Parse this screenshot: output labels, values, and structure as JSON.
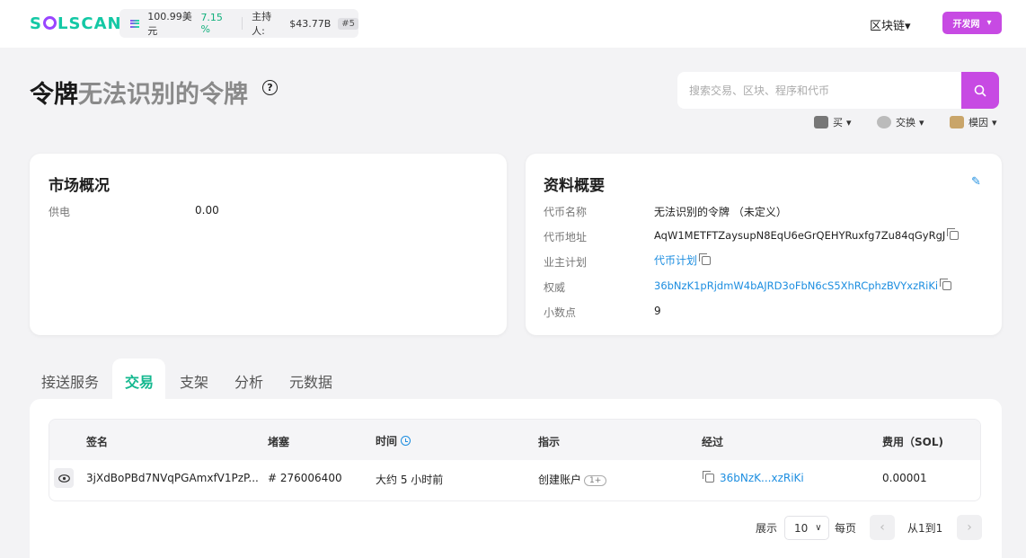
{
  "header": {
    "logo": "SOLSCAN",
    "price": "100.99美元",
    "change": "7.15 %",
    "supply_label": "主持人:",
    "supply_value": "$43.77B",
    "rank": "#5",
    "chain_menu": "区块链",
    "dev_button": "开发网"
  },
  "title": {
    "prefix": "令牌",
    "name": "无法识别的令牌"
  },
  "search": {
    "placeholder": "搜索交易、区块、程序和代币"
  },
  "quick_links": [
    {
      "label": "买"
    },
    {
      "label": "交换"
    },
    {
      "label": "模因"
    }
  ],
  "market": {
    "title": "市场概况",
    "rows": [
      {
        "label": "供电",
        "value": "0.00"
      }
    ]
  },
  "profile": {
    "title": "资料概要",
    "rows": [
      {
        "label": "代币名称",
        "value": "无法识别的令牌 （未定义）"
      },
      {
        "label": "代币地址",
        "value": "AqW1METFTZaysupN8EqU6eGrQEHYRuxfg7Zu84qGyRgJ"
      },
      {
        "label": "业主计划",
        "value": "代币计划"
      },
      {
        "label": "权威",
        "value": "36bNzK1pRjdmW4bAJRD3oFbN6cS5XhRCphzBVYxzRiKi"
      },
      {
        "label": "小数点",
        "value": "9"
      }
    ]
  },
  "tabs": [
    {
      "label": "接送服务"
    },
    {
      "label": "交易"
    },
    {
      "label": "支架"
    },
    {
      "label": "分析"
    },
    {
      "label": "元数据"
    }
  ],
  "table": {
    "columns": [
      "签名",
      "堵塞",
      "时间",
      "指示",
      "经过",
      "费用（SOL)"
    ],
    "rows": [
      {
        "signature": "3jXdBoPBd7NVqPGAmxfV1PzP...",
        "block": "# 276006400",
        "time": "大约 5 小时前",
        "instruction": "创建账户",
        "instruction_badge": "1+",
        "by": "36bNzK...xzRiKi",
        "fee": "0.00001"
      }
    ]
  },
  "pagination": {
    "show_label": "展示",
    "page_size": "10",
    "per_page_label": "每页",
    "range_label": "从1到1"
  }
}
